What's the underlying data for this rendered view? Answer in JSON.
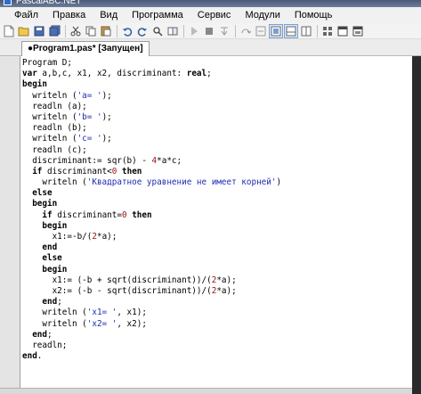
{
  "window": {
    "title": "PascalABC.NET"
  },
  "menu": [
    "Файл",
    "Правка",
    "Вид",
    "Программа",
    "Сервис",
    "Модули",
    "Помощь"
  ],
  "toolbar": {
    "buttons": [
      "new-file-icon",
      "open-file-icon",
      "save-icon",
      "save-all-icon",
      "cut-icon",
      "copy-icon",
      "paste-icon",
      "undo-icon",
      "redo-icon",
      "find-icon",
      "replace-icon",
      "run-icon",
      "stop-icon",
      "step-into-icon",
      "step-over-icon",
      "step-out-icon",
      "toggle-panel-icon",
      "output-panel-icon",
      "layout-icon",
      "module-icon",
      "form-designer-icon",
      "window-icon"
    ]
  },
  "tab": {
    "label": "●Program1.pas* [Запущен]"
  },
  "code": [
    [
      [
        "t",
        "Program D;"
      ]
    ],
    [
      [
        "k",
        "var"
      ],
      [
        "t",
        " a,b,c, x1, x2, discriminant: "
      ],
      [
        "k",
        "real"
      ],
      [
        "t",
        ";"
      ]
    ],
    [
      [
        "k",
        "begin"
      ]
    ],
    [
      [
        "t",
        "  writeln ("
      ],
      [
        "s",
        "'a= '"
      ],
      [
        "t",
        ");"
      ]
    ],
    [
      [
        "t",
        "  readln (a);"
      ]
    ],
    [
      [
        "t",
        "  writeln ("
      ],
      [
        "s",
        "'b= '"
      ],
      [
        "t",
        ");"
      ]
    ],
    [
      [
        "t",
        "  readln (b);"
      ]
    ],
    [
      [
        "t",
        "  writeln ("
      ],
      [
        "s",
        "'c= '"
      ],
      [
        "t",
        ");"
      ]
    ],
    [
      [
        "t",
        "  readln (c);"
      ]
    ],
    [
      [
        "t",
        "  discriminant:= sqr(b) - "
      ],
      [
        "n",
        "4"
      ],
      [
        "t",
        "*a*c;"
      ]
    ],
    [
      [
        "t",
        "  "
      ],
      [
        "k",
        "if"
      ],
      [
        "t",
        " discriminant<"
      ],
      [
        "n",
        "0"
      ],
      [
        "t",
        " "
      ],
      [
        "k",
        "then"
      ]
    ],
    [
      [
        "t",
        "    writeln ("
      ],
      [
        "s",
        "'Квадратное уравнение не имеет корней'"
      ],
      [
        "t",
        ")"
      ]
    ],
    [
      [
        "t",
        "  "
      ],
      [
        "k",
        "else"
      ]
    ],
    [
      [
        "t",
        "  "
      ],
      [
        "k",
        "begin"
      ]
    ],
    [
      [
        "t",
        "    "
      ],
      [
        "k",
        "if"
      ],
      [
        "t",
        " discriminant="
      ],
      [
        "n",
        "0"
      ],
      [
        "t",
        " "
      ],
      [
        "k",
        "then"
      ]
    ],
    [
      [
        "t",
        "    "
      ],
      [
        "k",
        "begin"
      ]
    ],
    [
      [
        "t",
        "      x1:=-b/("
      ],
      [
        "n",
        "2"
      ],
      [
        "t",
        "*a);"
      ]
    ],
    [
      [
        "t",
        "    "
      ],
      [
        "k",
        "end"
      ]
    ],
    [
      [
        "t",
        "    "
      ],
      [
        "k",
        "else"
      ]
    ],
    [
      [
        "t",
        "    "
      ],
      [
        "k",
        "begin"
      ]
    ],
    [
      [
        "t",
        "      x1:= (-b + sqrt(discriminant))/("
      ],
      [
        "n",
        "2"
      ],
      [
        "t",
        "*a);"
      ]
    ],
    [
      [
        "t",
        "      x2:= (-b - sqrt(discriminant))/("
      ],
      [
        "n",
        "2"
      ],
      [
        "t",
        "*a);"
      ]
    ],
    [
      [
        "t",
        "    "
      ],
      [
        "k",
        "end"
      ],
      [
        "t",
        ";"
      ]
    ],
    [
      [
        "t",
        "    writeln ("
      ],
      [
        "s",
        "'x1= '"
      ],
      [
        "t",
        ", x1);"
      ]
    ],
    [
      [
        "t",
        "    writeln ("
      ],
      [
        "s",
        "'x2= '"
      ],
      [
        "t",
        ", x2);"
      ]
    ],
    [
      [
        "t",
        "  "
      ],
      [
        "k",
        "end"
      ],
      [
        "t",
        ";"
      ]
    ],
    [
      [
        "t",
        "  readln;"
      ]
    ],
    [
      [
        "k",
        "end"
      ],
      [
        "t",
        "."
      ]
    ]
  ]
}
